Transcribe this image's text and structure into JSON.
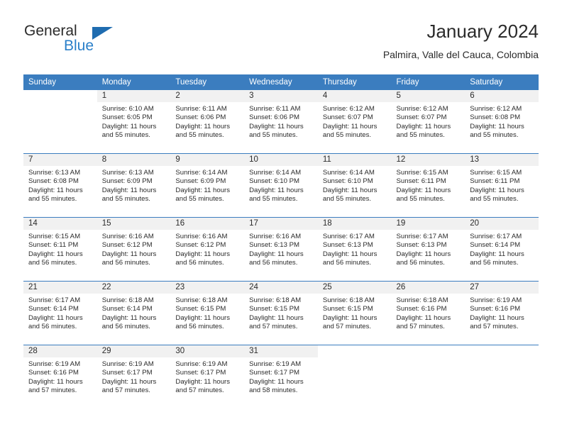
{
  "brand": {
    "word1": "General",
    "word2": "Blue",
    "triangle_color": "#1f6cb0",
    "blue_color": "#2a7fc9"
  },
  "header": {
    "title": "January 2024",
    "subtitle": "Palmira, Valle del Cauca, Colombia"
  },
  "theme": {
    "header_row_bg": "#3b7dbf",
    "daynum_bg": "#f1f1f1",
    "text": "#2b2b2b"
  },
  "weekday_headers": [
    "Sunday",
    "Monday",
    "Tuesday",
    "Wednesday",
    "Thursday",
    "Friday",
    "Saturday"
  ],
  "weeks": [
    [
      {
        "day": "",
        "sunrise": "",
        "sunset": "",
        "daylight1": "",
        "daylight2": ""
      },
      {
        "day": "1",
        "sunrise": "Sunrise: 6:10 AM",
        "sunset": "Sunset: 6:05 PM",
        "daylight1": "Daylight: 11 hours",
        "daylight2": "and 55 minutes."
      },
      {
        "day": "2",
        "sunrise": "Sunrise: 6:11 AM",
        "sunset": "Sunset: 6:06 PM",
        "daylight1": "Daylight: 11 hours",
        "daylight2": "and 55 minutes."
      },
      {
        "day": "3",
        "sunrise": "Sunrise: 6:11 AM",
        "sunset": "Sunset: 6:06 PM",
        "daylight1": "Daylight: 11 hours",
        "daylight2": "and 55 minutes."
      },
      {
        "day": "4",
        "sunrise": "Sunrise: 6:12 AM",
        "sunset": "Sunset: 6:07 PM",
        "daylight1": "Daylight: 11 hours",
        "daylight2": "and 55 minutes."
      },
      {
        "day": "5",
        "sunrise": "Sunrise: 6:12 AM",
        "sunset": "Sunset: 6:07 PM",
        "daylight1": "Daylight: 11 hours",
        "daylight2": "and 55 minutes."
      },
      {
        "day": "6",
        "sunrise": "Sunrise: 6:12 AM",
        "sunset": "Sunset: 6:08 PM",
        "daylight1": "Daylight: 11 hours",
        "daylight2": "and 55 minutes."
      }
    ],
    [
      {
        "day": "7",
        "sunrise": "Sunrise: 6:13 AM",
        "sunset": "Sunset: 6:08 PM",
        "daylight1": "Daylight: 11 hours",
        "daylight2": "and 55 minutes."
      },
      {
        "day": "8",
        "sunrise": "Sunrise: 6:13 AM",
        "sunset": "Sunset: 6:09 PM",
        "daylight1": "Daylight: 11 hours",
        "daylight2": "and 55 minutes."
      },
      {
        "day": "9",
        "sunrise": "Sunrise: 6:14 AM",
        "sunset": "Sunset: 6:09 PM",
        "daylight1": "Daylight: 11 hours",
        "daylight2": "and 55 minutes."
      },
      {
        "day": "10",
        "sunrise": "Sunrise: 6:14 AM",
        "sunset": "Sunset: 6:10 PM",
        "daylight1": "Daylight: 11 hours",
        "daylight2": "and 55 minutes."
      },
      {
        "day": "11",
        "sunrise": "Sunrise: 6:14 AM",
        "sunset": "Sunset: 6:10 PM",
        "daylight1": "Daylight: 11 hours",
        "daylight2": "and 55 minutes."
      },
      {
        "day": "12",
        "sunrise": "Sunrise: 6:15 AM",
        "sunset": "Sunset: 6:11 PM",
        "daylight1": "Daylight: 11 hours",
        "daylight2": "and 55 minutes."
      },
      {
        "day": "13",
        "sunrise": "Sunrise: 6:15 AM",
        "sunset": "Sunset: 6:11 PM",
        "daylight1": "Daylight: 11 hours",
        "daylight2": "and 55 minutes."
      }
    ],
    [
      {
        "day": "14",
        "sunrise": "Sunrise: 6:15 AM",
        "sunset": "Sunset: 6:11 PM",
        "daylight1": "Daylight: 11 hours",
        "daylight2": "and 56 minutes."
      },
      {
        "day": "15",
        "sunrise": "Sunrise: 6:16 AM",
        "sunset": "Sunset: 6:12 PM",
        "daylight1": "Daylight: 11 hours",
        "daylight2": "and 56 minutes."
      },
      {
        "day": "16",
        "sunrise": "Sunrise: 6:16 AM",
        "sunset": "Sunset: 6:12 PM",
        "daylight1": "Daylight: 11 hours",
        "daylight2": "and 56 minutes."
      },
      {
        "day": "17",
        "sunrise": "Sunrise: 6:16 AM",
        "sunset": "Sunset: 6:13 PM",
        "daylight1": "Daylight: 11 hours",
        "daylight2": "and 56 minutes."
      },
      {
        "day": "18",
        "sunrise": "Sunrise: 6:17 AM",
        "sunset": "Sunset: 6:13 PM",
        "daylight1": "Daylight: 11 hours",
        "daylight2": "and 56 minutes."
      },
      {
        "day": "19",
        "sunrise": "Sunrise: 6:17 AM",
        "sunset": "Sunset: 6:13 PM",
        "daylight1": "Daylight: 11 hours",
        "daylight2": "and 56 minutes."
      },
      {
        "day": "20",
        "sunrise": "Sunrise: 6:17 AM",
        "sunset": "Sunset: 6:14 PM",
        "daylight1": "Daylight: 11 hours",
        "daylight2": "and 56 minutes."
      }
    ],
    [
      {
        "day": "21",
        "sunrise": "Sunrise: 6:17 AM",
        "sunset": "Sunset: 6:14 PM",
        "daylight1": "Daylight: 11 hours",
        "daylight2": "and 56 minutes."
      },
      {
        "day": "22",
        "sunrise": "Sunrise: 6:18 AM",
        "sunset": "Sunset: 6:14 PM",
        "daylight1": "Daylight: 11 hours",
        "daylight2": "and 56 minutes."
      },
      {
        "day": "23",
        "sunrise": "Sunrise: 6:18 AM",
        "sunset": "Sunset: 6:15 PM",
        "daylight1": "Daylight: 11 hours",
        "daylight2": "and 56 minutes."
      },
      {
        "day": "24",
        "sunrise": "Sunrise: 6:18 AM",
        "sunset": "Sunset: 6:15 PM",
        "daylight1": "Daylight: 11 hours",
        "daylight2": "and 57 minutes."
      },
      {
        "day": "25",
        "sunrise": "Sunrise: 6:18 AM",
        "sunset": "Sunset: 6:15 PM",
        "daylight1": "Daylight: 11 hours",
        "daylight2": "and 57 minutes."
      },
      {
        "day": "26",
        "sunrise": "Sunrise: 6:18 AM",
        "sunset": "Sunset: 6:16 PM",
        "daylight1": "Daylight: 11 hours",
        "daylight2": "and 57 minutes."
      },
      {
        "day": "27",
        "sunrise": "Sunrise: 6:19 AM",
        "sunset": "Sunset: 6:16 PM",
        "daylight1": "Daylight: 11 hours",
        "daylight2": "and 57 minutes."
      }
    ],
    [
      {
        "day": "28",
        "sunrise": "Sunrise: 6:19 AM",
        "sunset": "Sunset: 6:16 PM",
        "daylight1": "Daylight: 11 hours",
        "daylight2": "and 57 minutes."
      },
      {
        "day": "29",
        "sunrise": "Sunrise: 6:19 AM",
        "sunset": "Sunset: 6:17 PM",
        "daylight1": "Daylight: 11 hours",
        "daylight2": "and 57 minutes."
      },
      {
        "day": "30",
        "sunrise": "Sunrise: 6:19 AM",
        "sunset": "Sunset: 6:17 PM",
        "daylight1": "Daylight: 11 hours",
        "daylight2": "and 57 minutes."
      },
      {
        "day": "31",
        "sunrise": "Sunrise: 6:19 AM",
        "sunset": "Sunset: 6:17 PM",
        "daylight1": "Daylight: 11 hours",
        "daylight2": "and 58 minutes."
      },
      {
        "day": "",
        "sunrise": "",
        "sunset": "",
        "daylight1": "",
        "daylight2": ""
      },
      {
        "day": "",
        "sunrise": "",
        "sunset": "",
        "daylight1": "",
        "daylight2": ""
      },
      {
        "day": "",
        "sunrise": "",
        "sunset": "",
        "daylight1": "",
        "daylight2": ""
      }
    ]
  ]
}
